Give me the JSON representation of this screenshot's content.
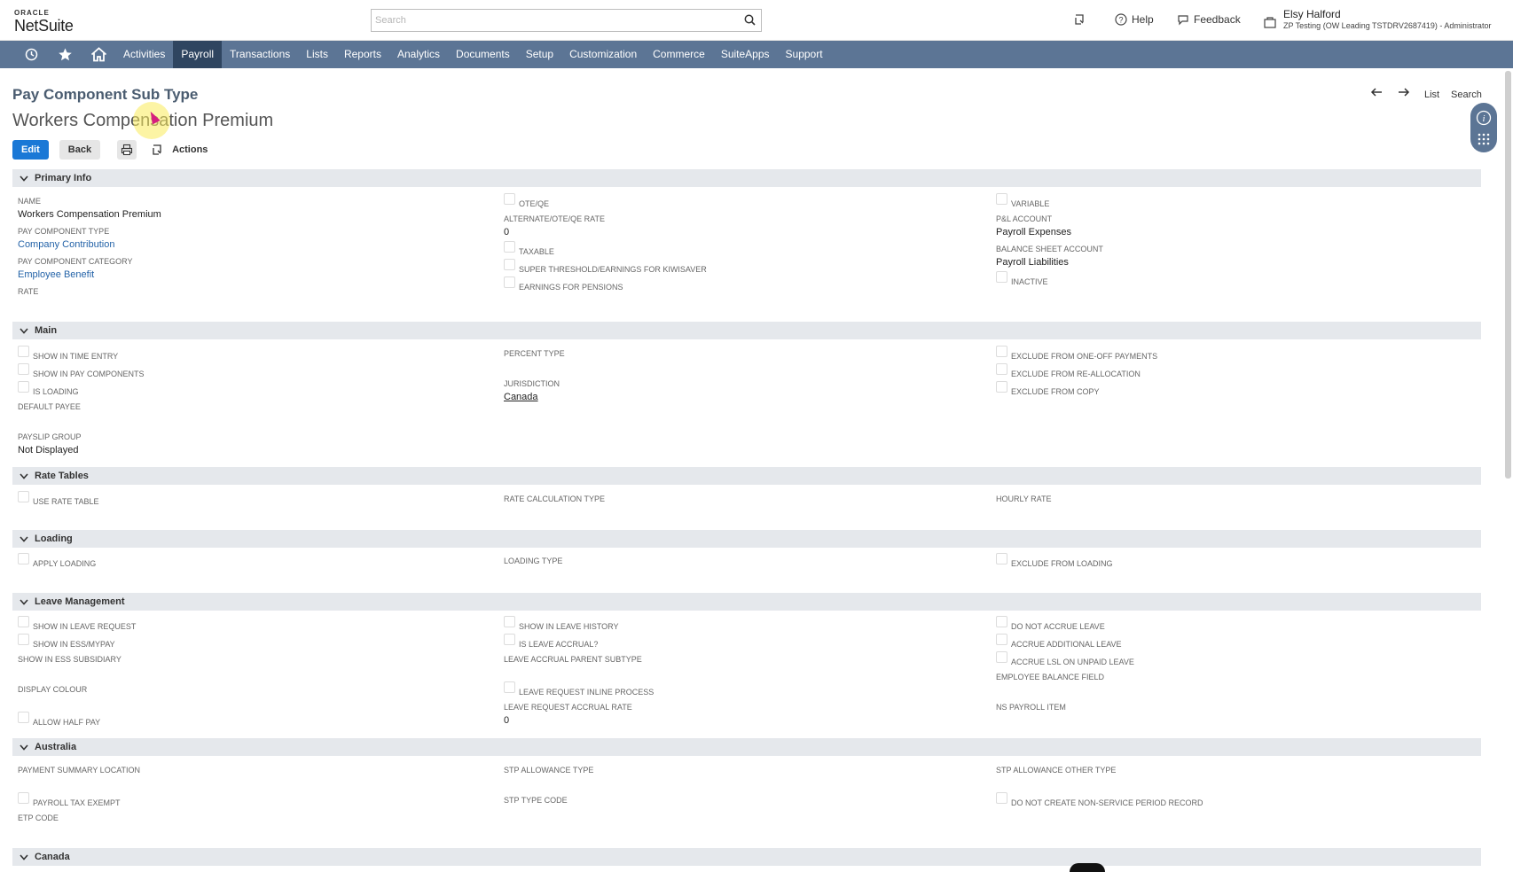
{
  "header": {
    "logo_oracle": "ORACLE",
    "logo_netsuite": "NetSuite",
    "search_placeholder": "Search",
    "help_label": "Help",
    "feedback_label": "Feedback",
    "user_name": "Elsy Halford",
    "user_role": "ZP Testing (OW Leading TSTDRV2687419) - Administrator"
  },
  "nav": {
    "items": [
      "Activities",
      "Payroll",
      "Transactions",
      "Lists",
      "Reports",
      "Analytics",
      "Documents",
      "Setup",
      "Customization",
      "Commerce",
      "SuiteApps",
      "Support"
    ],
    "active": "Payroll"
  },
  "record": {
    "type": "Pay Component Sub Type",
    "name": "Workers Compensation Premium",
    "list_label": "List",
    "search_label": "Search"
  },
  "buttons": {
    "edit": "Edit",
    "back": "Back",
    "actions": "Actions"
  },
  "sections": {
    "primary_info": {
      "title": "Primary Info",
      "name_label": "NAME",
      "name_value": "Workers Compensation Premium",
      "pay_component_type_label": "PAY COMPONENT TYPE",
      "pay_component_type_value": "Company Contribution",
      "pay_component_category_label": "PAY COMPONENT CATEGORY",
      "pay_component_category_value": "Employee Benefit",
      "rate_label": "RATE",
      "ote_qe": "OTE/QE",
      "alt_rate_label": "ALTERNATE/OTE/QE RATE",
      "alt_rate_value": "0",
      "taxable": "TAXABLE",
      "super_threshold": "SUPER THRESHOLD/EARNINGS FOR KIWISAVER",
      "earnings_pensions": "EARNINGS FOR PENSIONS",
      "variable": "VARIABLE",
      "pl_account_label": "P&L ACCOUNT",
      "pl_account_value": "Payroll Expenses",
      "balance_sheet_label": "BALANCE SHEET ACCOUNT",
      "balance_sheet_value": "Payroll Liabilities",
      "inactive": "INACTIVE"
    },
    "main": {
      "title": "Main",
      "show_time_entry": "SHOW IN TIME ENTRY",
      "show_pay_components": "SHOW IN PAY COMPONENTS",
      "is_loading": "IS LOADING",
      "default_payee_label": "DEFAULT PAYEE",
      "payslip_group_label": "PAYSLIP GROUP",
      "payslip_group_value": "Not Displayed",
      "percent_type_label": "PERCENT TYPE",
      "jurisdiction_label": "JURISDICTION",
      "jurisdiction_value": "Canada",
      "exclude_one_off": "EXCLUDE FROM ONE-OFF PAYMENTS",
      "exclude_reallocation": "EXCLUDE FROM RE-ALLOCATION",
      "exclude_copy": "EXCLUDE FROM COPY"
    },
    "rate_tables": {
      "title": "Rate Tables",
      "use_rate_table": "USE RATE TABLE",
      "rate_calc_type_label": "RATE CALCULATION TYPE",
      "hourly_rate_label": "HOURLY RATE"
    },
    "loading": {
      "title": "Loading",
      "apply_loading": "APPLY LOADING",
      "loading_type_label": "LOADING TYPE",
      "exclude_loading": "EXCLUDE FROM LOADING"
    },
    "leave_management": {
      "title": "Leave Management",
      "show_leave_request": "SHOW IN LEAVE REQUEST",
      "show_ess": "SHOW IN ESS/MYPAY",
      "show_ess_subsidiary_label": "SHOW IN ESS SUBSIDIARY",
      "display_colour_label": "DISPLAY COLOUR",
      "allow_half_pay": "ALLOW HALF PAY",
      "show_leave_history": "SHOW IN LEAVE HISTORY",
      "is_leave_accrual": "IS LEAVE ACCRUAL?",
      "leave_accrual_parent_label": "LEAVE ACCRUAL PARENT SUBTYPE",
      "leave_request_inline": "LEAVE REQUEST INLINE PROCESS",
      "leave_request_accrual_rate_label": "LEAVE REQUEST ACCRUAL RATE",
      "leave_request_accrual_rate_value": "0",
      "do_not_accrue": "DO NOT ACCRUE LEAVE",
      "accrue_additional": "ACCRUE ADDITIONAL LEAVE",
      "accrue_lsl": "ACCRUE LSL ON UNPAID LEAVE",
      "employee_balance_label": "EMPLOYEE BALANCE FIELD",
      "ns_payroll_item_label": "NS PAYROLL ITEM"
    },
    "australia": {
      "title": "Australia",
      "payment_summary_label": "PAYMENT SUMMARY LOCATION",
      "payroll_tax_exempt": "PAYROLL TAX EXEMPT",
      "etp_code_label": "ETP CODE",
      "stp_allowance_type_label": "STP ALLOWANCE TYPE",
      "stp_type_code_label": "STP TYPE CODE",
      "stp_allowance_other_label": "STP ALLOWANCE OTHER TYPE",
      "do_not_create_nonservice": "DO NOT CREATE NON-SERVICE PERIOD RECORD"
    },
    "canada": {
      "title": "Canada"
    }
  },
  "colors": {
    "nav_bg": "#5c7595",
    "nav_active": "#2f4560",
    "edit_button": "#1a78d6",
    "section_bg": "#e5e8ec",
    "link": "#2463a8"
  }
}
